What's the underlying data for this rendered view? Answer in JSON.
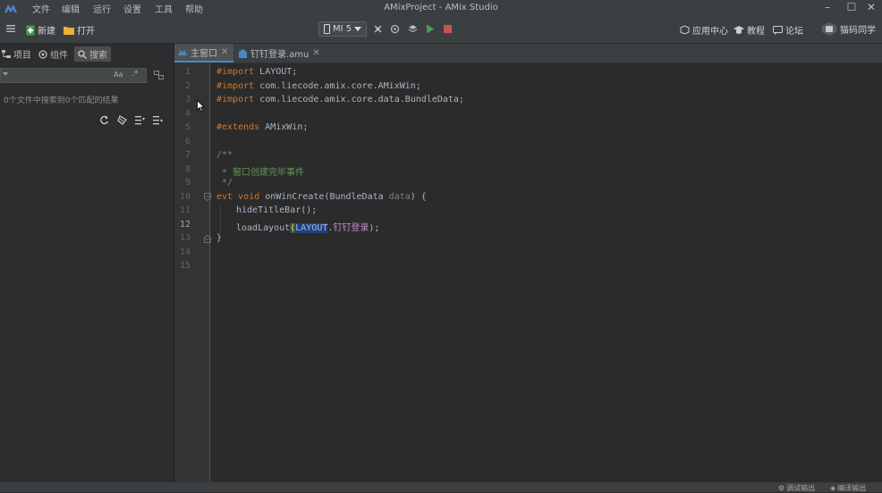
{
  "app": {
    "window_title": "AMixProject - AMix Studio",
    "menu": [
      "文件",
      "编辑",
      "运行",
      "设置",
      "工具",
      "帮助"
    ]
  },
  "toolbar": {
    "new_label": "新建",
    "open_label": "打开",
    "device_label": "MI 5",
    "app_center_label": "应用中心",
    "tutorial_label": "教程",
    "forum_label": "论坛",
    "user_label": "猫码同学"
  },
  "left_panel": {
    "tabs": [
      "项目",
      "组件",
      "搜索"
    ],
    "active_tab": "搜索",
    "search_value": "",
    "search_case_label": "Aa",
    "search_regex_label": ".*",
    "result_text": "0个文件中搜索到0个匹配的结果"
  },
  "editor": {
    "tabs": [
      {
        "label": "主窗口",
        "active": true
      },
      {
        "label": "钉钉登录.amu",
        "active": false
      }
    ],
    "line_numbers": [
      "1",
      "2",
      "3",
      "4",
      "5",
      "6",
      "7",
      "8",
      "9",
      "10",
      "11",
      "12",
      "13",
      "14",
      "15"
    ],
    "current_line": "12",
    "lines": {
      "l1": {
        "kw": "#import",
        "rest": " LAYOUT;"
      },
      "l2": {
        "kw": "#import",
        "rest": " com.liecode.amix.core.AMixWin;"
      },
      "l3": {
        "kw": "#import",
        "rest": " com.liecode.amix.core.data.BundleData;"
      },
      "l5": {
        "kw": "#extends",
        "rest": " AMixWin;"
      },
      "l7": "/**",
      "l8": " * 窗口创建完毕事件",
      "l9": " */",
      "l10": {
        "kw": "evt void",
        "rest": " onWinCreate(BundleData ",
        "param": "data",
        "tail": ") {"
      },
      "l11": "hideTitleBar();",
      "l12": {
        "fn": "loadLayout",
        "open": "(",
        "ref": "LAYOUT",
        "dot": ".",
        "str": "钉钉登录",
        "close": ");"
      },
      "l13": "}"
    }
  },
  "status_bar": {
    "debug_output_label": "调试输出",
    "compile_output_label": "编译输出"
  },
  "colors": {
    "keyword": "#cc7832",
    "comment": "#629755",
    "accent": "#4a88c7",
    "run": "#499c54",
    "stop": "#c75450"
  }
}
